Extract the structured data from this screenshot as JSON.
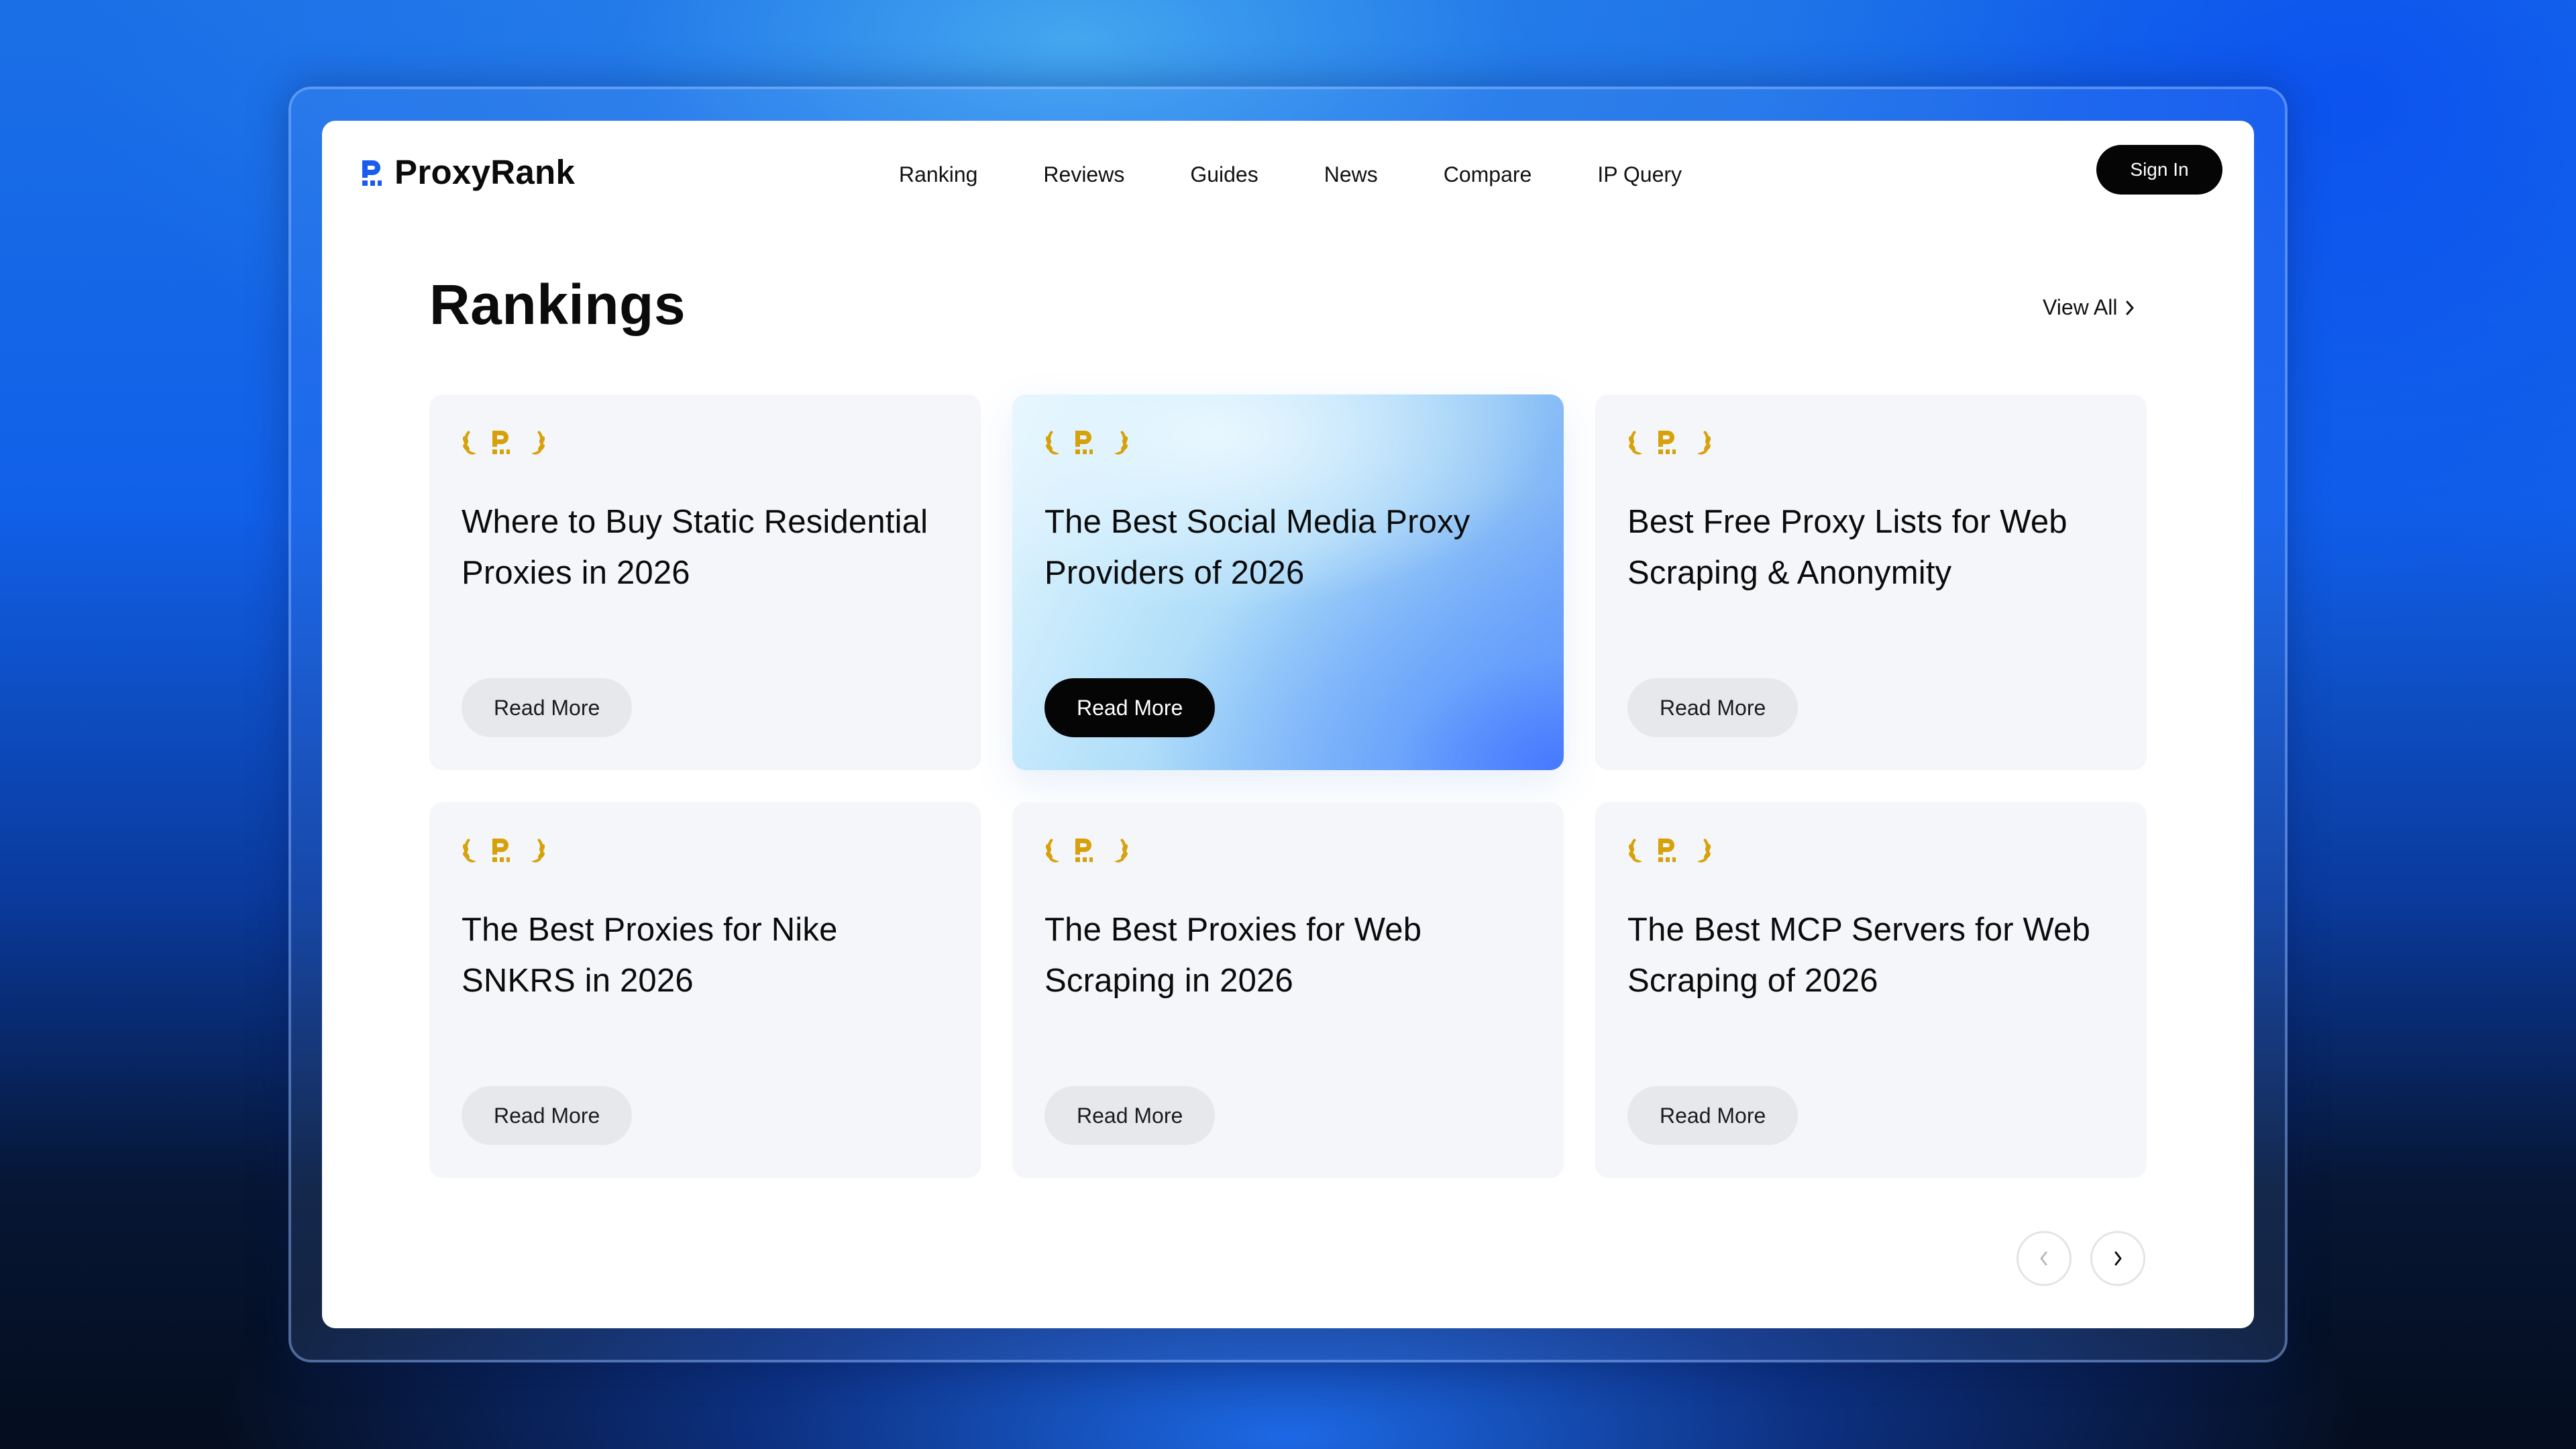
{
  "brand": {
    "name": "ProxyRank",
    "logo_icon": "proxyrank-logo-icon",
    "accent": "#1a5cf0"
  },
  "nav": {
    "items": [
      {
        "label": "Ranking"
      },
      {
        "label": "Reviews"
      },
      {
        "label": "Guides"
      },
      {
        "label": "News"
      },
      {
        "label": "Compare"
      },
      {
        "label": "IP Query"
      }
    ]
  },
  "header": {
    "signin_label": "Sign In"
  },
  "section": {
    "title": "Rankings",
    "view_all_label": "View All",
    "view_all_icon": "chevron-right-icon"
  },
  "cards": [
    {
      "title": "Where to Buy Static Residential Proxies in 2026",
      "button": "Read More",
      "featured": false
    },
    {
      "title": "The Best Social Media Proxy Providers of 2026",
      "button": "Read More",
      "featured": true
    },
    {
      "title": "Best Free Proxy Lists for Web Scraping & Anonymity",
      "button": "Read More",
      "featured": false
    },
    {
      "title": "The Best Proxies for Nike SNKRS in 2026",
      "button": "Read More",
      "featured": false
    },
    {
      "title": "The Best Proxies for Web Scraping in 2026",
      "button": "Read More",
      "featured": false
    },
    {
      "title": "The Best MCP Servers for Web Scraping of 2026",
      "button": "Read More",
      "featured": false
    }
  ],
  "badge": {
    "icon": "laurel-award-icon",
    "color": "#d6a10a"
  },
  "pagination": {
    "prev_icon": "chevron-left-icon",
    "next_icon": "chevron-right-icon",
    "prev_disabled": true
  },
  "colors": {
    "button_dark": "#050505",
    "card_bg": "#f5f6f9",
    "button_light": "#e7e8ec"
  }
}
